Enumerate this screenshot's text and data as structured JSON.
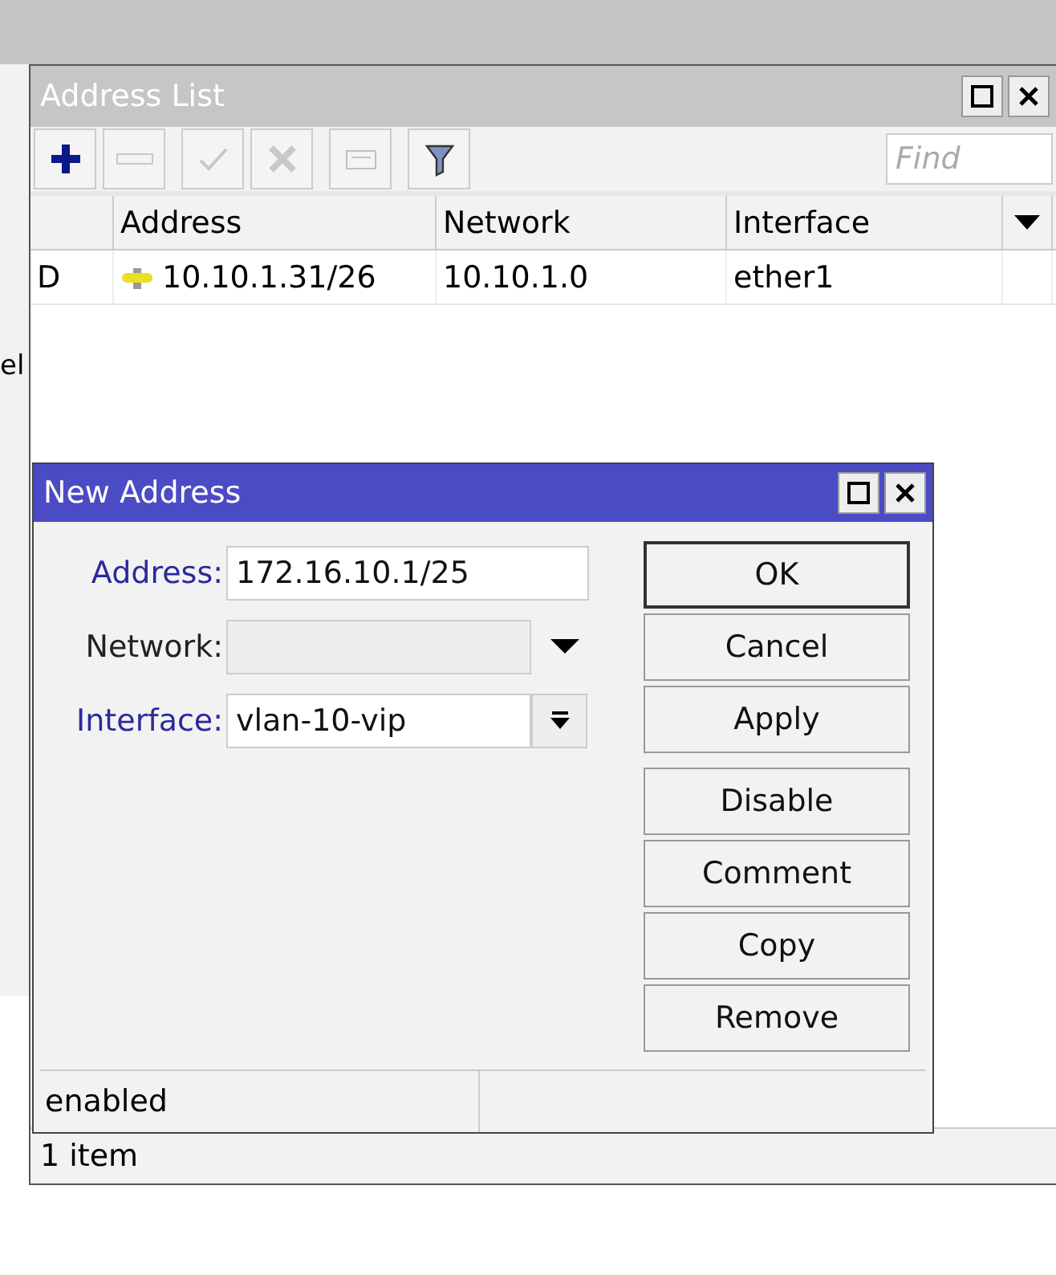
{
  "background_window": {
    "fragment": "el"
  },
  "address_list": {
    "title": "Address List",
    "toolbar": [
      {
        "kind": "add",
        "disabled": false
      },
      {
        "kind": "remove",
        "disabled": true
      },
      {
        "kind": "enable",
        "disabled": true
      },
      {
        "kind": "disable",
        "disabled": true
      },
      {
        "kind": "comment",
        "disabled": true
      },
      {
        "kind": "filter",
        "disabled": false
      }
    ],
    "find": {
      "placeholder": "Find"
    },
    "columns": [
      "Address",
      "Network",
      "Interface"
    ],
    "rows": [
      {
        "flag": "D",
        "address": "10.10.1.31/26",
        "network": "10.10.1.0",
        "interface": "ether1"
      }
    ],
    "status": "1 item"
  },
  "new_address": {
    "title": "New Address",
    "fields": [
      {
        "label": "Address:",
        "value": "172.16.10.1/25",
        "kind": "text",
        "changed": true
      },
      {
        "label": "Network:",
        "kind": "dropdown",
        "changed": false
      },
      {
        "label": "Interface:",
        "value": "vlan-10-vip",
        "kind": "combo",
        "changed": true
      }
    ],
    "buttons": [
      {
        "label": "OK",
        "focused": true
      },
      {
        "label": "Cancel",
        "focused": false
      },
      {
        "label": "Apply",
        "focused": false
      },
      {
        "label": "Disable",
        "focused": false
      },
      {
        "label": "Comment",
        "focused": false
      },
      {
        "label": "Copy",
        "focused": false
      },
      {
        "label": "Remove",
        "focused": false
      }
    ],
    "status": "enabled"
  }
}
